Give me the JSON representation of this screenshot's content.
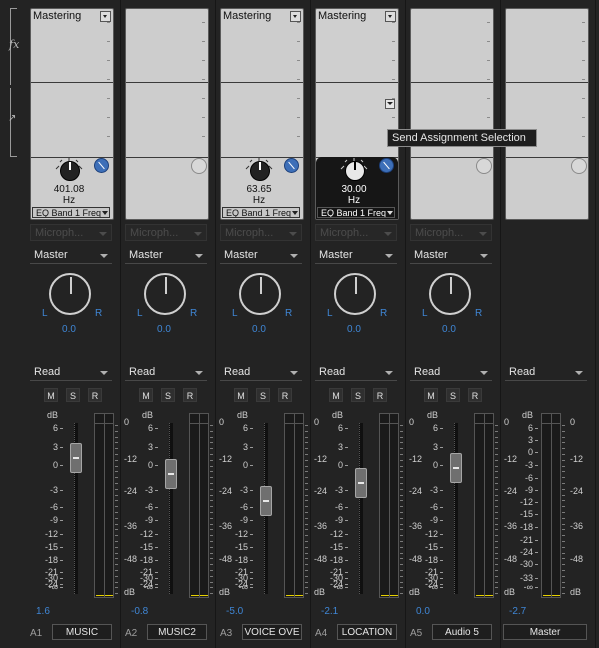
{
  "rail": {
    "fx_label": "fx"
  },
  "tooltip": {
    "text": "Send Assignment Selection"
  },
  "channels": [
    {
      "slot_effect": "Mastering",
      "freq_value": "401.08",
      "freq_unit": "Hz",
      "param_select": "EQ Band 1 Freq",
      "input_label": "Microph...",
      "output": "Master",
      "pan_L": "L",
      "pan_R": "R",
      "pan_value": "0.0",
      "automation": "Read",
      "mute": "M",
      "solo": "S",
      "rec": "R",
      "volume": "1.6",
      "track_id": "A1",
      "track_name": "MUSIC"
    },
    {
      "slot_effect": "",
      "freq_value": "",
      "freq_unit": "",
      "param_select": "",
      "input_label": "Microph...",
      "output": "Master",
      "pan_L": "L",
      "pan_R": "R",
      "pan_value": "0.0",
      "automation": "Read",
      "mute": "M",
      "solo": "S",
      "rec": "R",
      "volume": "-0.8",
      "track_id": "A2",
      "track_name": "MUSIC2"
    },
    {
      "slot_effect": "Mastering",
      "freq_value": "63.65",
      "freq_unit": "Hz",
      "param_select": "EQ Band 1 Freq",
      "input_label": "Microph...",
      "output": "Master",
      "pan_L": "L",
      "pan_R": "R",
      "pan_value": "0.0",
      "automation": "Read",
      "mute": "M",
      "solo": "S",
      "rec": "R",
      "volume": "-5.0",
      "track_id": "A3",
      "track_name": "VOICE OVE"
    },
    {
      "slot_effect": "Mastering",
      "freq_value": "30.00",
      "freq_unit": "Hz",
      "param_select": "EQ Band 1 Freq",
      "input_label": "Microph...",
      "output": "Master",
      "pan_L": "L",
      "pan_R": "R",
      "pan_value": "0.0",
      "automation": "Read",
      "mute": "M",
      "solo": "S",
      "rec": "R",
      "volume": "-2.1",
      "track_id": "A4",
      "track_name": "LOCATION"
    },
    {
      "slot_effect": "",
      "freq_value": "",
      "freq_unit": "",
      "param_select": "",
      "input_label": "Microph...",
      "output": "Master",
      "pan_L": "L",
      "pan_R": "R",
      "pan_value": "0.0",
      "automation": "Read",
      "mute": "M",
      "solo": "S",
      "rec": "R",
      "volume": "0.0",
      "track_id": "A5",
      "track_name": "Audio 5"
    },
    {
      "slot_effect": "",
      "freq_value": "",
      "freq_unit": "",
      "param_select": "",
      "input_label": "",
      "output": "",
      "pan_L": "",
      "pan_R": "",
      "pan_value": "",
      "automation": "Read",
      "mute": "",
      "solo": "",
      "rec": "",
      "volume": "-2.7",
      "track_id": "",
      "track_name": "Master"
    }
  ],
  "fader_scale": [
    "dB",
    "6",
    "3",
    "0",
    "-3",
    "-6",
    "-9",
    "-12",
    "-15",
    "-18",
    "-21",
    "-24",
    "-30",
    "-∞"
  ],
  "master_fader_scale": [
    "dB",
    "6",
    "3",
    "0",
    "-3",
    "-6",
    "-9",
    "-12",
    "-15",
    "-18",
    "-21",
    "-24",
    "-30",
    "-33",
    "-∞"
  ],
  "meter_scale": [
    "0",
    "-12",
    "-24",
    "-36",
    "-48",
    "dB"
  ],
  "fader_levels_db": [
    1.6,
    -0.8,
    -5.0,
    -2.1,
    0.0,
    -2.7
  ],
  "colors": {
    "accent_blue": "#3f86d5",
    "meter_yellow": "#e8d200",
    "background": "#232323"
  }
}
